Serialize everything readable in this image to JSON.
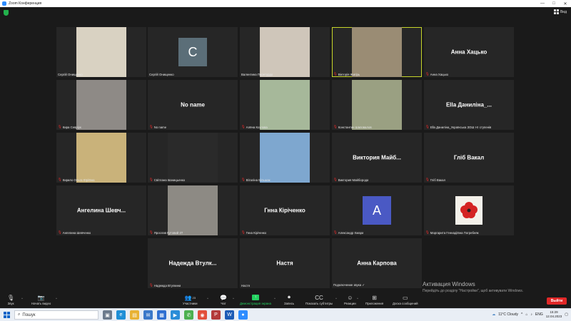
{
  "window": {
    "title": "Zoom Конференция"
  },
  "topbar": {
    "view_label": "Вид"
  },
  "tiles": [
    {
      "label": "Сергій Онищенко",
      "type": "video",
      "bg": "#d9d2c2",
      "muted": false
    },
    {
      "label": "Сергій Онищенко",
      "type": "avatar",
      "letter": "C",
      "avatar_color": "#5b6e78",
      "muted": false
    },
    {
      "label": "Валентина Перетурдо",
      "type": "video",
      "bg": "#cfc6ba",
      "muted": false
    },
    {
      "label": "Вікторія Жигірь",
      "type": "video",
      "bg": "#9a8c74",
      "muted": true,
      "active": true
    },
    {
      "label": "Анна Хацько",
      "type": "name",
      "display_name": "Анна Хацько",
      "muted": true
    },
    {
      "label": "Кира Севрiук",
      "type": "video",
      "bg": "#8e8a86",
      "muted": true
    },
    {
      "label": "No name",
      "type": "name",
      "display_name": "No name",
      "muted": true
    },
    {
      "label": "Алёна Козлова",
      "type": "video",
      "bg": "#a6b89a",
      "muted": true
    },
    {
      "label": "Константин Шаповалов",
      "type": "video",
      "bg": "#9aa082",
      "muted": true
    },
    {
      "label": "Ella Даниліна_Українська ЗОШ І-ІІ ступенів",
      "type": "name",
      "display_name": "Ella  Даниліна_...",
      "muted": true
    },
    {
      "label": "Кирило Ольга Юріївна",
      "type": "video",
      "bg": "#c9b27a",
      "muted": true
    },
    {
      "label": "Світлана Іваницьенко",
      "type": "video",
      "bg": "#2a2a2a",
      "muted": true
    },
    {
      "label": "Віталіна Більшак",
      "type": "video",
      "bg": "#7ea7cf",
      "muted": true
    },
    {
      "label": "Виктория Майборода",
      "type": "name",
      "display_name": "Виктория  Майб...",
      "muted": true
    },
    {
      "label": "Гліб Вакал",
      "type": "name",
      "display_name": "Гліб Вакал",
      "muted": true
    },
    {
      "label": "Ангелина Шевченко",
      "type": "name",
      "display_name": "Ангелина  Шевч...",
      "muted": true
    },
    {
      "label": "Ярослав Кутовий 4Т",
      "type": "video",
      "bg": "#8d8a84",
      "muted": true
    },
    {
      "label": "Гнна Кіріченко",
      "type": "name",
      "display_name": "Гнна Кіріченко",
      "muted": true
    },
    {
      "label": "Александр Хмара",
      "type": "avatar",
      "letter": "A",
      "avatar_color": "#4a59c4",
      "muted": true
    },
    {
      "label": "Маргарита Геннадіївна Погребняк",
      "type": "flower",
      "muted": true
    },
    {
      "label": "Надежда Втулкина",
      "type": "name",
      "display_name": "Надежда  Втулк...",
      "muted": true
    },
    {
      "label": "Настя",
      "type": "name",
      "display_name": "Настя",
      "muted": false
    },
    {
      "label": "Подключение звука ✓",
      "type": "name",
      "display_name": "Анна Карпова",
      "muted": false
    }
  ],
  "watermark": {
    "line1": "Активация Windows",
    "line2": "Перейдіть до розділу \"Настройки\", щоб активувати Windows."
  },
  "toolbar": {
    "audio": "Звук",
    "video": "Начать видео",
    "participants": "Участники",
    "participants_count": "23",
    "chat": "Чат",
    "share": "Демонстрация экрана",
    "record": "Запись",
    "captions": "Показать субтитры",
    "reactions": "Реакции",
    "apps": "Приложения",
    "whiteboard": "Доска сообщений",
    "leave": "Выйти"
  },
  "taskbar": {
    "search_placeholder": "Пошук",
    "weather": "11°C  Cloudy",
    "lang": "ENG",
    "time": "15:29",
    "date": "12.04.2023"
  },
  "colors": {
    "active_outline": "#c7d62a",
    "leave": "#e02828",
    "share": "#23d160"
  }
}
